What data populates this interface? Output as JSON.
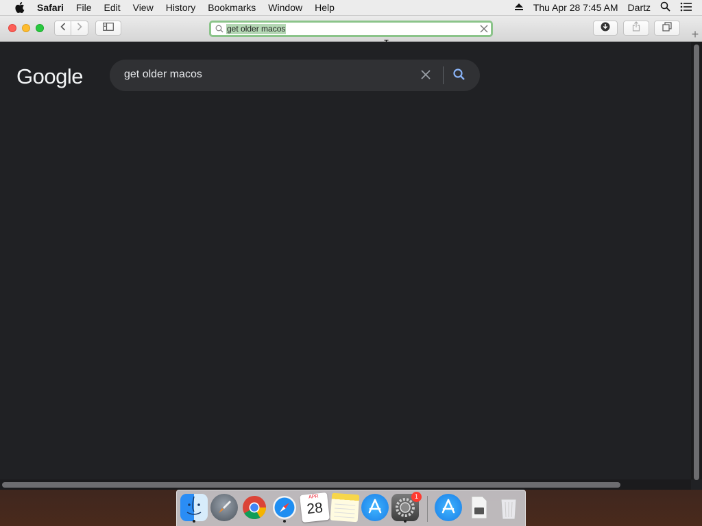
{
  "menubar": {
    "app_name": "Safari",
    "items": [
      "File",
      "Edit",
      "View",
      "History",
      "Bookmarks",
      "Window",
      "Help"
    ],
    "clock": "Thu Apr 28  7:45 AM",
    "user": "Dartz"
  },
  "toolbar": {
    "address_text": "get older macos"
  },
  "page": {
    "logo_text": "Google",
    "search_query": "get older macos"
  },
  "dock": {
    "calendar_month": "APR",
    "calendar_day": "28",
    "settings_badge": "1",
    "apps": [
      "Finder",
      "Launchpad",
      "Google Chrome",
      "Safari",
      "Calendar",
      "Notes",
      "App Store",
      "System Preferences",
      "App Store",
      "Disk Image",
      "Trash"
    ]
  },
  "colors": {
    "page_bg": "#202124",
    "searchbox_bg": "#303134",
    "search_icon": "#8ab4f8",
    "address_focus": "#8bc48a"
  }
}
